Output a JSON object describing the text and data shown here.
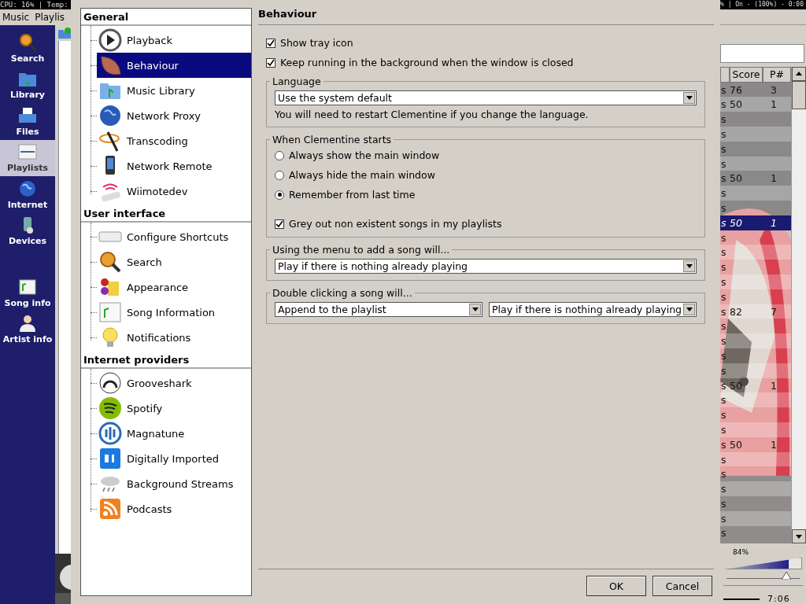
{
  "top_bar": {
    "left": "CPU:  16% | Temp:",
    "right": "% | On - (100%) - 0:00"
  },
  "menu_bar": [
    "Music",
    "Playlis"
  ],
  "sidebar": {
    "items": [
      {
        "label": "Search",
        "selected": false
      },
      {
        "label": "Library",
        "selected": false
      },
      {
        "label": "Files",
        "selected": false
      },
      {
        "label": "Playlists",
        "selected": true
      },
      {
        "label": "Internet",
        "selected": false
      },
      {
        "label": "Devices",
        "selected": false
      }
    ],
    "bottom_items": [
      {
        "label": "Song info",
        "selected": false
      },
      {
        "label": "Artist info",
        "selected": false
      }
    ]
  },
  "dialog": {
    "tree": [
      {
        "label": "General",
        "children": [
          {
            "label": "Playback",
            "selected": false
          },
          {
            "label": "Behaviour",
            "selected": true
          },
          {
            "label": "Music Library",
            "selected": false
          },
          {
            "label": "Network Proxy",
            "selected": false
          },
          {
            "label": "Transcoding",
            "selected": false
          },
          {
            "label": "Network Remote",
            "selected": false
          },
          {
            "label": "Wiimotedev",
            "selected": false
          }
        ]
      },
      {
        "label": "User interface",
        "children": [
          {
            "label": "Configure Shortcuts",
            "selected": false
          },
          {
            "label": "Search",
            "selected": false
          },
          {
            "label": "Appearance",
            "selected": false
          },
          {
            "label": "Song Information",
            "selected": false
          },
          {
            "label": "Notifications",
            "selected": false
          }
        ]
      },
      {
        "label": "Internet providers",
        "children": [
          {
            "label": "Grooveshark",
            "selected": false
          },
          {
            "label": "Spotify",
            "selected": false
          },
          {
            "label": "Magnatune",
            "selected": false
          },
          {
            "label": "Digitally Imported",
            "selected": false
          },
          {
            "label": "Background Streams",
            "selected": false
          },
          {
            "label": "Podcasts",
            "selected": false
          }
        ]
      }
    ],
    "title": "Behaviour",
    "checkboxes": [
      {
        "label": "Show tray icon",
        "checked": true
      },
      {
        "label": "Keep running in the background when the window is closed",
        "checked": true
      }
    ],
    "groups": [
      {
        "title": "Language",
        "controls": [
          {
            "kind": "dropdown",
            "value": "Use the system default"
          },
          {
            "kind": "note",
            "text": "You will need to restart Clementine if you change the language."
          }
        ]
      },
      {
        "title": "When Clementine starts",
        "controls": [
          {
            "kind": "radio",
            "label": "Always show the main window",
            "selected": false
          },
          {
            "kind": "radio",
            "label": "Always hide the main window",
            "selected": false
          },
          {
            "kind": "radio",
            "label": "Remember from last time",
            "selected": true
          },
          {
            "kind": "checkbox",
            "label": "Grey out non existent songs in my playlists",
            "checked": true
          }
        ]
      },
      {
        "title": "Using the menu to add a song will...",
        "controls": [
          {
            "kind": "dropdown",
            "value": "Play if there is nothing already playing"
          }
        ]
      },
      {
        "title": "Double clicking a song will...",
        "controls": [
          {
            "kind": "dropdown_pair",
            "values": [
              "Append to the playlist",
              "Play if there is nothing already playing"
            ]
          }
        ]
      }
    ],
    "buttons": [
      "OK",
      "Cancel"
    ]
  },
  "playlist": {
    "columns": [
      "Score",
      "P#"
    ],
    "rows": [
      {
        "column_1": "s",
        "score": "76",
        "p": "3",
        "selected": false
      },
      {
        "column_1": "s",
        "score": "50",
        "p": "1",
        "selected": false
      },
      {
        "column_1": "s",
        "selected": false
      },
      {
        "column_1": "s",
        "selected": false
      },
      {
        "column_1": "s",
        "selected": false
      },
      {
        "column_1": "s",
        "selected": false
      },
      {
        "column_1": "s",
        "score": "50",
        "p": "1",
        "selected": false
      },
      {
        "column_1": "s",
        "selected": false
      },
      {
        "column_1": "s",
        "selected": false
      },
      {
        "column_1": "s",
        "score": "50",
        "p": "1",
        "selected": true
      },
      {
        "column_1": "s",
        "selected": false
      },
      {
        "column_1": "s",
        "selected": false
      },
      {
        "column_1": "s",
        "selected": false
      },
      {
        "column_1": "s",
        "selected": false
      },
      {
        "column_1": "s",
        "selected": false
      },
      {
        "column_1": "s",
        "score": "82",
        "p": "7",
        "selected": false
      },
      {
        "column_1": "s",
        "selected": false
      },
      {
        "column_1": "s",
        "selected": false
      },
      {
        "column_1": "s",
        "selected": false
      },
      {
        "column_1": "s",
        "selected": false
      },
      {
        "column_1": "s",
        "score": "50",
        "p": "1",
        "selected": false
      },
      {
        "column_1": "s",
        "selected": false
      },
      {
        "column_1": "s",
        "selected": false
      },
      {
        "column_1": "s",
        "selected": false
      },
      {
        "column_1": "s",
        "score": "50",
        "p": "1",
        "selected": false
      },
      {
        "column_1": "s",
        "selected": false
      },
      {
        "column_1": "s",
        "selected": false
      },
      {
        "column_1": "s",
        "selected": false
      },
      {
        "column_1": "s",
        "selected": false
      },
      {
        "column_1": "s",
        "selected": false
      },
      {
        "column_1": "s",
        "selected": false
      }
    ]
  },
  "volume": {
    "reading": "84%",
    "level": 0.84
  },
  "position": {
    "time": "7:06",
    "level": 0.82
  }
}
